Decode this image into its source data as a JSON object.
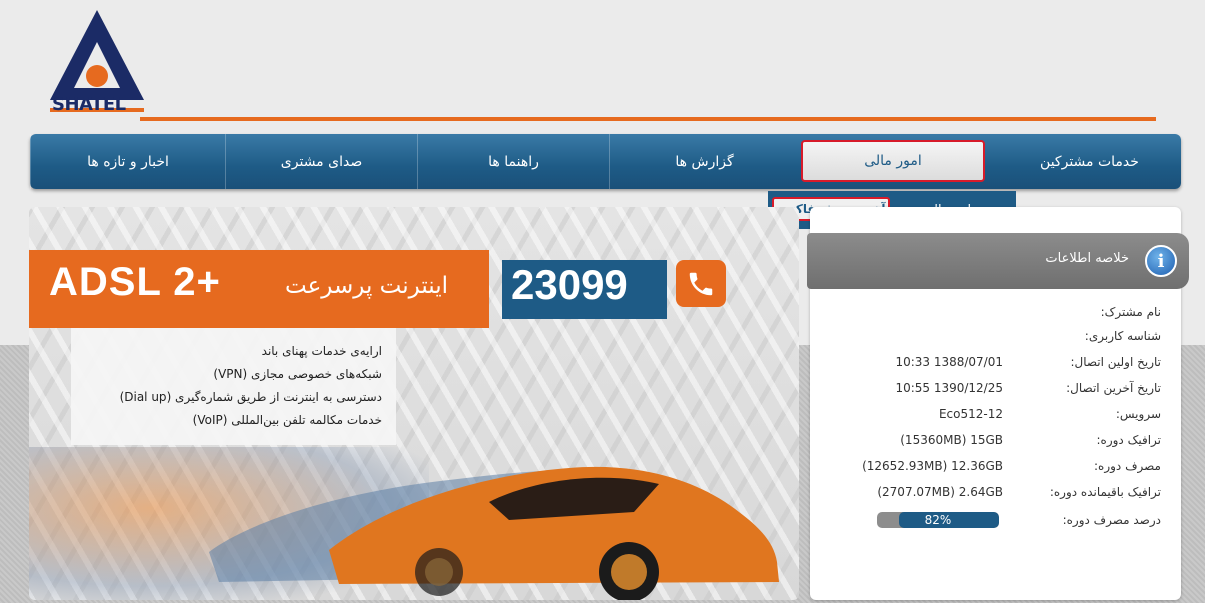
{
  "logo": {
    "text": "SHATEL"
  },
  "nav": {
    "items": [
      {
        "label": "خدمات مشترکین"
      },
      {
        "label": "امور مالی"
      },
      {
        "label": "گزارش ها"
      },
      {
        "label": "راهنما ها"
      },
      {
        "label": "صدای مشتری"
      },
      {
        "label": "اخبار و تازه ها"
      }
    ],
    "active_index": 1
  },
  "submenu": {
    "items": [
      {
        "label": "سوابق مالی"
      },
      {
        "label": "آخرین پیش فاکتور"
      }
    ],
    "active_index": 1
  },
  "banner": {
    "adsl": "ADSL 2+",
    "headline": "اینترنت پرسرعت",
    "phone": "23099",
    "services": [
      "ارایه‌ی خدمات پهنای باند",
      "شبکه‌های خصوصی مجازی (VPN)",
      "دسترسی به اینترنت از طریق شماره‌گیری (Dial up)",
      "خدمات مکالمه تلفن بین‌المللی (VoIP)"
    ]
  },
  "panel": {
    "title": "خلاصه اطلاعات",
    "rows": [
      {
        "label": "نام مشترک:",
        "value": ""
      },
      {
        "label": "شناسه کاربری:",
        "value": ""
      },
      {
        "label": "تاریخ اولین اتصال:",
        "value": "10:33 1388/07/01"
      },
      {
        "label": "تاریخ آخرین اتصال:",
        "value": "10:55 1390/12/25"
      },
      {
        "label": "سرویس:",
        "value": "Eco512-12"
      },
      {
        "label": "ترافیک دوره:",
        "value": "(15360MB) 15GB"
      },
      {
        "label": "مصرف دوره:",
        "value": "(12652.93MB) 12.36GB"
      },
      {
        "label": "ترافیک باقیمانده دوره:",
        "value": "(2707.07MB) 2.64GB"
      },
      {
        "label": "درصد مصرف دوره:",
        "value": ""
      }
    ],
    "usage_percent": 82,
    "usage_label": "82%"
  },
  "colors": {
    "brand_blue": "#1e5b86",
    "brand_orange": "#e66a1f",
    "highlight_red": "#d71b2a"
  }
}
